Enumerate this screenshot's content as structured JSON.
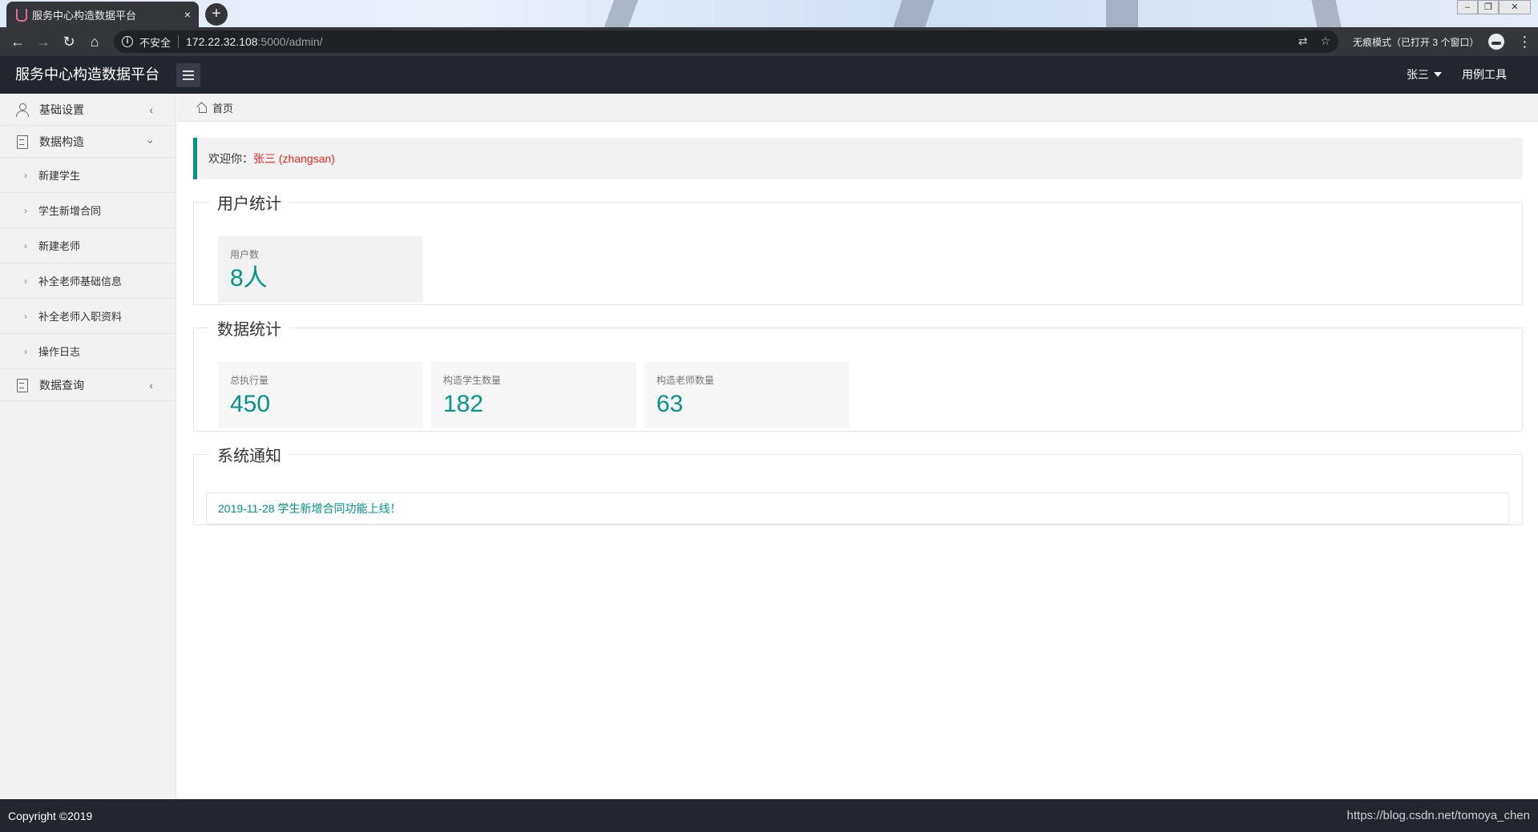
{
  "browser": {
    "tab_title": "服务中心构造数据平台",
    "tab_close": "×",
    "new_tab": "+",
    "url_security": "不安全",
    "url_host": "172.22.32.108",
    "url_path": ":5000/admin/",
    "incognito_text": "无痕模式（已打开 3 个窗口）",
    "back_icon": "←",
    "forward_icon": "→",
    "reload_icon": "↻",
    "home_icon": "⌂",
    "translate_icon": "⇄",
    "star_icon": "☆",
    "menu_icon": "⋮",
    "win_min": "‒",
    "win_restore": "❐",
    "win_close": "✕"
  },
  "header": {
    "brand": "服务中心构造数据平台",
    "user": "张三",
    "tools": "用例工具"
  },
  "sidebar": {
    "items": [
      {
        "label": "基础设置",
        "icon": "user-icon",
        "arrow": "‹",
        "expanded": false
      },
      {
        "label": "数据构造",
        "icon": "document-icon",
        "arrow": "‹",
        "expanded": true
      },
      {
        "label": "数据查询",
        "icon": "document-icon",
        "arrow": "‹",
        "expanded": false
      }
    ],
    "sub_items": [
      {
        "label": "新建学生",
        "chev": "›"
      },
      {
        "label": "学生新增合同",
        "chev": "›"
      },
      {
        "label": "新建老师",
        "chev": "›"
      },
      {
        "label": "补全老师基础信息",
        "chev": "›"
      },
      {
        "label": "补全老师入职资料",
        "chev": "›"
      },
      {
        "label": "操作日志",
        "chev": "›"
      }
    ]
  },
  "breadcrumb": {
    "home": "首页"
  },
  "welcome": {
    "prefix": "欢迎你：",
    "user": "张三 (zhangsan)"
  },
  "user_stats": {
    "title": "用户统计",
    "cards": [
      {
        "label": "用户数",
        "value": "8人"
      }
    ]
  },
  "data_stats": {
    "title": "数据统计",
    "cards": [
      {
        "label": "总执行量",
        "value": "450"
      },
      {
        "label": "构造学生数量",
        "value": "182"
      },
      {
        "label": "构造老师数量",
        "value": "63"
      }
    ]
  },
  "notice": {
    "title": "系统通知",
    "items": [
      "2019-11-28 学生新增合同功能上线！"
    ]
  },
  "footer": {
    "copyright": "Copyright ©2019",
    "watermark": "https://blog.csdn.net/tomoya_chen"
  },
  "colors": {
    "accent": "#009688",
    "header_bg": "#23262e",
    "welcome_name": "#ff2222"
  }
}
